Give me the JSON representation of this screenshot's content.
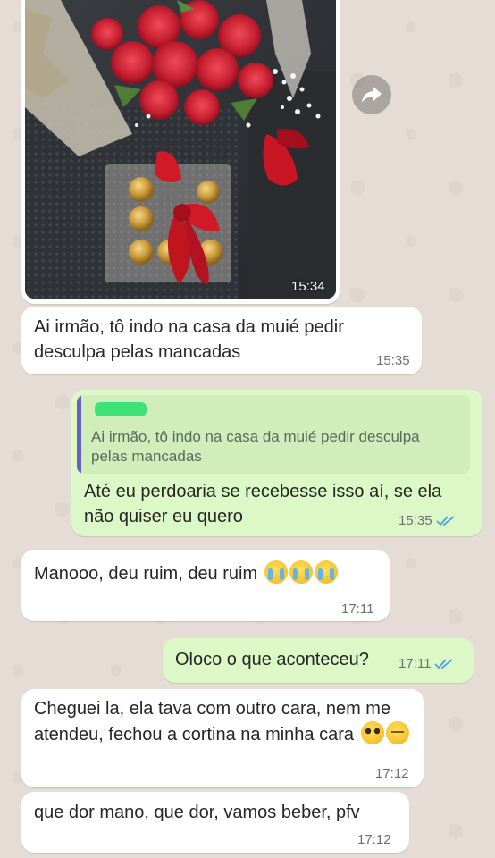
{
  "messages": [
    {
      "id": "m1",
      "direction": "in",
      "type": "image",
      "image_subject": "bouquet-of-red-roses-and-ferrero-chocolates",
      "time": "15:34"
    },
    {
      "id": "m2",
      "direction": "in",
      "text": "Ai irmão, tô indo na casa da muié pedir desculpa pelas mancadas",
      "time": "15:35"
    },
    {
      "id": "m3",
      "direction": "out",
      "quote": {
        "text": "Ai irmão, tô indo na casa da muié pedir desculpa pelas mancadas"
      },
      "text": "Até eu perdoaria se recebesse isso aí, se ela não quiser eu quero",
      "time": "15:35",
      "read": true
    },
    {
      "id": "m4",
      "direction": "in",
      "text": "Manooo, deu ruim, deu ruim",
      "emojis": [
        "crying-face",
        "crying-face",
        "crying-face"
      ],
      "time": "17:11"
    },
    {
      "id": "m5",
      "direction": "out",
      "text": "Oloco o que aconteceu?",
      "time": "17:11",
      "read": true
    },
    {
      "id": "m6",
      "direction": "in",
      "text": "Cheguei la, ela tava com outro cara, nem me atendeu, fechou a cortina na minha cara",
      "emojis": [
        "pleading-face",
        "pensive-face"
      ],
      "time": "17:12"
    },
    {
      "id": "m7",
      "direction": "in",
      "text": "que dor mano, que dor, vamos beber, pfv",
      "time": "17:12"
    }
  ],
  "colors": {
    "chat_background": "#e5ddd5",
    "incoming_bubble": "#ffffff",
    "outgoing_bubble": "#dcf8c6",
    "read_ticks": "#4fa3e0",
    "quote_bar": "#6b5fc7",
    "quote_background": "#cfeebc"
  },
  "icons": {
    "forward": "forward-arrow-icon",
    "read": "double-check-icon"
  }
}
